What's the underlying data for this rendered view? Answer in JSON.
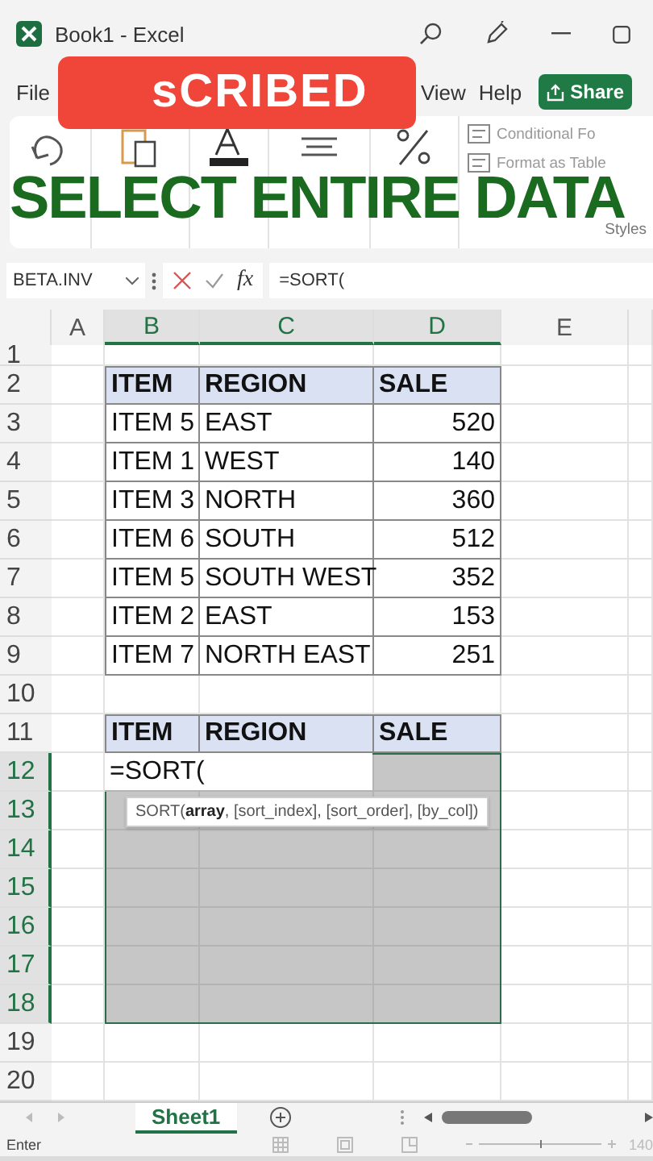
{
  "window": {
    "title": "Book1 - Excel"
  },
  "overlay_button": {
    "label": "sCRIBED"
  },
  "menu": {
    "items": [
      "File",
      "View",
      "Help"
    ],
    "share_button": "Share"
  },
  "ribbon": {
    "groups": [
      {
        "kind": "undo"
      },
      {
        "kind": "clipboard"
      },
      {
        "kind": "font"
      },
      {
        "kind": "alignment"
      },
      {
        "kind": "number"
      }
    ],
    "styles": {
      "items": [
        "Conditional Fo",
        "Format as Table"
      ],
      "label": "Styles"
    }
  },
  "caption": "SELECT ENTIRE DATA",
  "formula_bar": {
    "name_box": "BETA.INV",
    "fx": "fx",
    "formula": "=SORT("
  },
  "grid": {
    "columns": [
      {
        "label": "A",
        "selected": false
      },
      {
        "label": "B",
        "selected": true
      },
      {
        "label": "C",
        "selected": true
      },
      {
        "label": "D",
        "selected": true
      },
      {
        "label": "E",
        "selected": false
      }
    ],
    "rows": [
      {
        "label": "1",
        "selected": false
      },
      {
        "label": "2",
        "selected": false
      },
      {
        "label": "3",
        "selected": false
      },
      {
        "label": "4",
        "selected": false
      },
      {
        "label": "5",
        "selected": false
      },
      {
        "label": "6",
        "selected": false
      },
      {
        "label": "7",
        "selected": false
      },
      {
        "label": "8",
        "selected": false
      },
      {
        "label": "9",
        "selected": false
      },
      {
        "label": "10",
        "selected": false
      },
      {
        "label": "11",
        "selected": false
      },
      {
        "label": "12",
        "selected": true
      },
      {
        "label": "13",
        "selected": true
      },
      {
        "label": "14",
        "selected": true
      },
      {
        "label": "15",
        "selected": true
      },
      {
        "label": "16",
        "selected": true
      },
      {
        "label": "17",
        "selected": true
      },
      {
        "label": "18",
        "selected": true
      },
      {
        "label": "19",
        "selected": false
      },
      {
        "label": "20",
        "selected": false
      }
    ]
  },
  "source_table": {
    "columns": [
      "ITEM",
      "REGION",
      "SALE"
    ],
    "rows": [
      [
        "ITEM 5",
        "EAST",
        "520"
      ],
      [
        "ITEM 1",
        "WEST",
        "140"
      ],
      [
        "ITEM 3",
        "NORTH",
        "360"
      ],
      [
        "ITEM 6",
        "SOUTH",
        "512"
      ],
      [
        "ITEM 5",
        "SOUTH WEST",
        "352"
      ],
      [
        "ITEM 2",
        "EAST",
        "153"
      ],
      [
        "ITEM 7",
        "NORTH EAST",
        "251"
      ]
    ]
  },
  "result_table": {
    "columns": [
      "ITEM",
      "REGION",
      "SALE"
    ],
    "active_cell": "=SORT("
  },
  "tooltip": "SORT(**array**, [sort_index], [sort_order], [by_col])",
  "sheet_tabs": [
    {
      "label": "Sheet1",
      "selected": true
    }
  ],
  "status_bar": {
    "mode": "Enter",
    "zoom_slider": {
      "level": 0.5
    },
    "zoom": "140"
  }
}
